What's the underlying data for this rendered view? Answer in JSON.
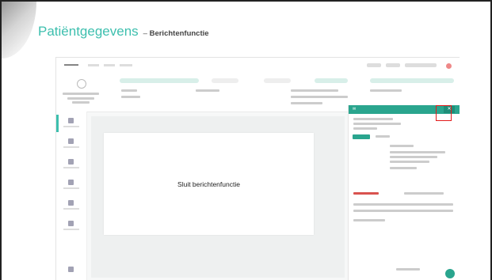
{
  "slide": {
    "title": "Patiëntgegevens",
    "separator": "–",
    "subtitle": "Berichtenfunctie"
  },
  "callout": {
    "text": "Sluit berichtenfunctie"
  },
  "colors": {
    "accent": "#3dbfae",
    "panel_header": "#2aa58e",
    "highlight": "#e21b1b"
  },
  "icons": {
    "close": "close-icon",
    "message": "message-icon",
    "avatar": "avatar-icon"
  }
}
